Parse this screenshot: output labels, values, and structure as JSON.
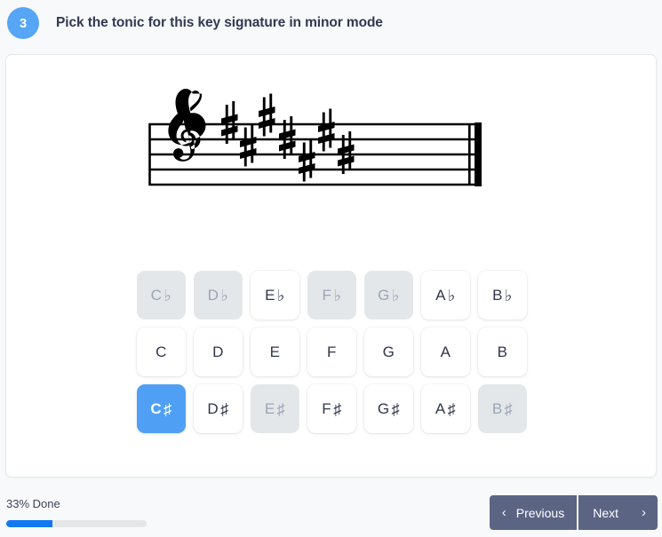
{
  "header": {
    "question_number": "3",
    "title": "Pick the tonic for this key signature in minor mode"
  },
  "notation": {
    "clef": "treble-clef",
    "key_signature_accidental": "sharp",
    "key_signature_count": 7,
    "key_signature_notes": [
      "F#",
      "C#",
      "G#",
      "D#",
      "A#",
      "E#",
      "B#"
    ],
    "barline": "thin-thick-double"
  },
  "answers": {
    "rows": [
      {
        "row_name": "flats",
        "buttons": [
          {
            "letter": "C",
            "accidental": "♭",
            "state": "disabled"
          },
          {
            "letter": "D",
            "accidental": "♭",
            "state": "disabled"
          },
          {
            "letter": "E",
            "accidental": "♭",
            "state": "enabled"
          },
          {
            "letter": "F",
            "accidental": "♭",
            "state": "disabled"
          },
          {
            "letter": "G",
            "accidental": "♭",
            "state": "disabled"
          },
          {
            "letter": "A",
            "accidental": "♭",
            "state": "enabled"
          },
          {
            "letter": "B",
            "accidental": "♭",
            "state": "enabled"
          }
        ]
      },
      {
        "row_name": "naturals",
        "buttons": [
          {
            "letter": "C",
            "accidental": "",
            "state": "enabled"
          },
          {
            "letter": "D",
            "accidental": "",
            "state": "enabled"
          },
          {
            "letter": "E",
            "accidental": "",
            "state": "enabled"
          },
          {
            "letter": "F",
            "accidental": "",
            "state": "enabled"
          },
          {
            "letter": "G",
            "accidental": "",
            "state": "enabled"
          },
          {
            "letter": "A",
            "accidental": "",
            "state": "enabled"
          },
          {
            "letter": "B",
            "accidental": "",
            "state": "enabled"
          }
        ]
      },
      {
        "row_name": "sharps",
        "buttons": [
          {
            "letter": "C",
            "accidental": "♯",
            "state": "selected"
          },
          {
            "letter": "D",
            "accidental": "♯",
            "state": "enabled"
          },
          {
            "letter": "E",
            "accidental": "♯",
            "state": "disabled"
          },
          {
            "letter": "F",
            "accidental": "♯",
            "state": "enabled"
          },
          {
            "letter": "G",
            "accidental": "♯",
            "state": "enabled"
          },
          {
            "letter": "A",
            "accidental": "♯",
            "state": "enabled"
          },
          {
            "letter": "B",
            "accidental": "♯",
            "state": "disabled"
          }
        ]
      }
    ]
  },
  "footer": {
    "progress_label": "33% Done",
    "progress_percent": 33,
    "previous_label": "Previous",
    "next_label": "Next",
    "prev_chevron": "‹",
    "next_chevron": "›"
  },
  "colors": {
    "accent_blue": "#4fa0f4",
    "badge_blue": "#57a5f5",
    "progress_blue": "#1178f0",
    "nav_slate": "#5c6484",
    "page_bg": "#f8f9fa",
    "card_bg": "#ffffff",
    "disabled_bg": "#e4e7ea",
    "disabled_text": "#9aa5b8",
    "text_dark": "#313851"
  }
}
